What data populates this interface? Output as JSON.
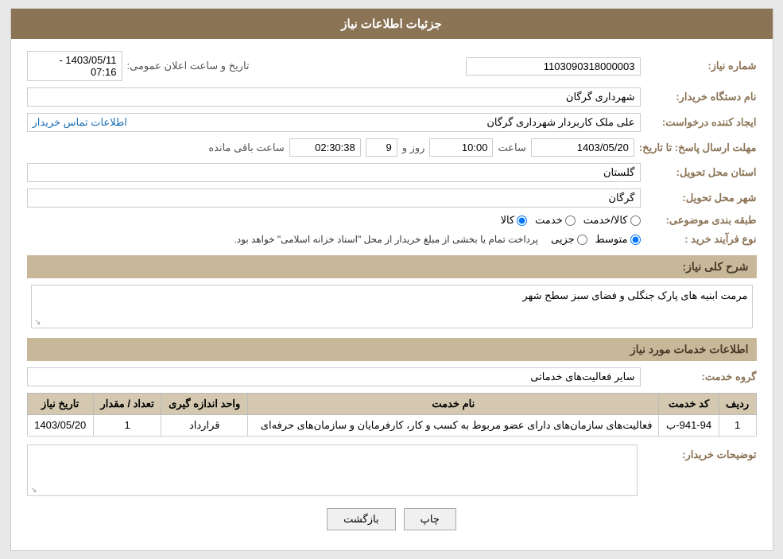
{
  "header": {
    "title": "جزئیات اطلاعات نیاز"
  },
  "labels": {
    "need_number": "شماره نیاز:",
    "buyer_org": "نام دستگاه خریدار:",
    "creator": "ایجاد کننده درخواست:",
    "deadline": "مهلت ارسال پاسخ: تا تاریخ:",
    "province": "استان محل تحویل:",
    "city": "شهر محل تحویل:",
    "category": "طبقه بندی موضوعی:",
    "purchase_type": "نوع فرآیند خرید :",
    "need_desc": "شرح کلی نیاز:",
    "services_header": "اطلاعات خدمات مورد نیاز",
    "service_group": "گروه خدمت:",
    "buyer_notes": "توضیحات خریدار:"
  },
  "values": {
    "need_number": "1103090318000003",
    "buyer_org": "شهرداری گرگان",
    "creator": "علی ملک کاربردار شهرداری گرگان",
    "creator_link": "اطلاعات تماس خریدار",
    "deadline_date": "1403/05/20",
    "deadline_time": "10:00",
    "deadline_days": "9",
    "deadline_remain": "02:30:38",
    "announcement_label": "تاریخ و ساعت اعلان عمومی:",
    "announcement_value": "1403/05/11 - 07:16",
    "province": "گلستان",
    "city": "گرگان",
    "category_options": [
      "کالا",
      "خدمت",
      "کالا/خدمت"
    ],
    "category_selected": "کالا",
    "purchase_type_options": [
      "جزیی",
      "متوسط"
    ],
    "purchase_type_selected": "متوسط",
    "purchase_note": "پرداخت تمام یا بخشی از مبلغ خریدار از محل \"اسناد خزانه اسلامی\" خواهد بود.",
    "need_description": "مرمت ابنیه های پارک جنگلی و فضای سبز سطح شهر",
    "service_group_value": "سایر فعالیت‌های خدماتی",
    "table_headers": [
      "ردیف",
      "کد خدمت",
      "نام خدمت",
      "واحد اندازه گیری",
      "تعداد / مقدار",
      "تاریخ نیاز"
    ],
    "table_rows": [
      {
        "row": "1",
        "code": "941-94-ب",
        "name": "فعالیت‌های سازمان‌های دارای عضو مربوط به کسب و کار، کارفرمایان و سازمان‌های حرفه‌ای",
        "unit": "قرارداد",
        "qty": "1",
        "date": "1403/05/20"
      }
    ],
    "buyer_notes_value": "",
    "btn_print": "چاپ",
    "btn_back": "بازگشت",
    "days_label": "روز و",
    "hours_remain_label": "ساعت باقی مانده"
  }
}
